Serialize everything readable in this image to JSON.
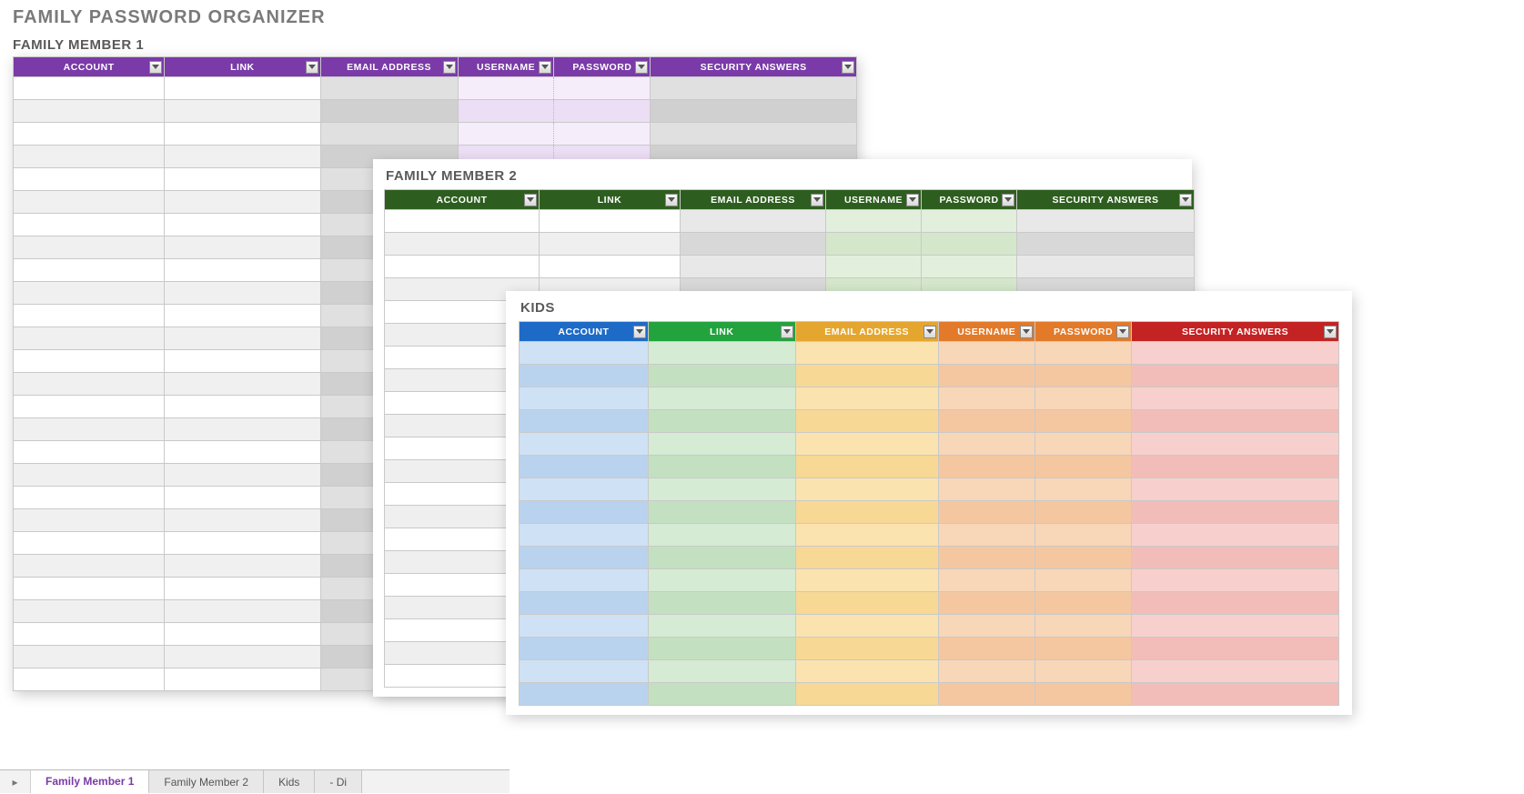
{
  "page_title": "FAMILY PASSWORD ORGANIZER",
  "sheets": {
    "member1": {
      "title": "FAMILY MEMBER 1",
      "columns": [
        "ACCOUNT",
        "LINK",
        "EMAIL ADDRESS",
        "USERNAME",
        "PASSWORD",
        "SECURITY ANSWERS"
      ],
      "rows": 27
    },
    "member2": {
      "title": "FAMILY MEMBER 2",
      "columns": [
        "ACCOUNT",
        "LINK",
        "EMAIL ADDRESS",
        "USERNAME",
        "PASSWORD",
        "SECURITY ANSWERS"
      ],
      "rows": 21
    },
    "kids": {
      "title": "KIDS",
      "columns": [
        "ACCOUNT",
        "LINK",
        "EMAIL ADDRESS",
        "USERNAME",
        "PASSWORD",
        "SECURITY ANSWERS"
      ],
      "rows": 16
    }
  },
  "tabs": {
    "items": [
      "Family Member 1",
      "Family Member 2",
      "Kids",
      "- Di"
    ],
    "active": 0
  }
}
